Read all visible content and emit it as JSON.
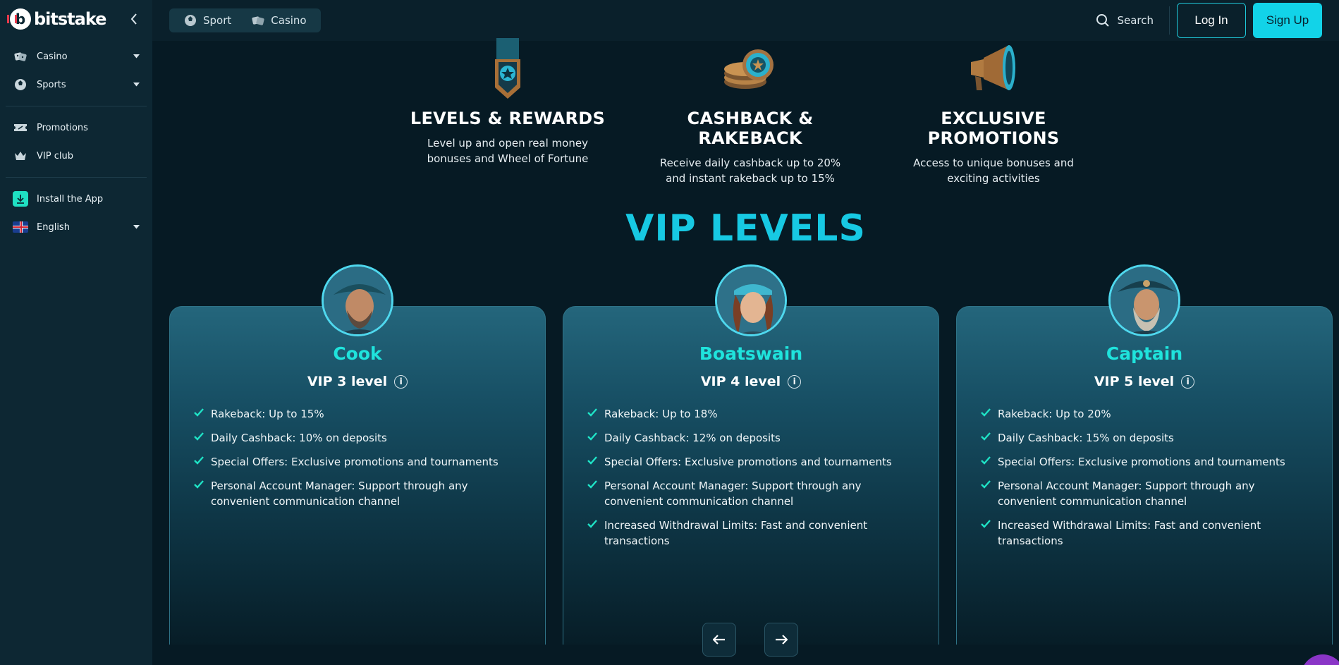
{
  "brand": {
    "name": "bitstake"
  },
  "sidebar": {
    "items": [
      {
        "label": "Casino",
        "icon": "dice-icon",
        "has_dropdown": true
      },
      {
        "label": "Sports",
        "icon": "ball-icon",
        "has_dropdown": true
      },
      {
        "label": "Promotions",
        "icon": "ticket-icon",
        "has_dropdown": false
      },
      {
        "label": "VIP club",
        "icon": "crown-icon",
        "has_dropdown": false
      },
      {
        "label": "Install the App",
        "icon": "download-icon",
        "has_dropdown": false
      },
      {
        "label": "English",
        "icon": "uk-flag-icon",
        "has_dropdown": true
      }
    ]
  },
  "topbar": {
    "tabs": [
      {
        "label": "Sport",
        "icon": "ball-icon"
      },
      {
        "label": "Casino",
        "icon": "dice-icon"
      }
    ],
    "search_label": "Search",
    "login_label": "Log In",
    "signup_label": "Sign Up"
  },
  "features": [
    {
      "title": "LEVELS & REWARDS",
      "text": "Level up and open real money\nbonuses and Wheel of Fortune",
      "icon": "medal-icon"
    },
    {
      "title": "CASHBACK & RAKEBACK",
      "text": "Receive daily cashback up to 20%\nand instant rakeback up to 15%",
      "icon": "coins-icon"
    },
    {
      "title": "EXCLUSIVE PROMOTIONS",
      "text": "Access to unique bonuses and\nexciting activities",
      "icon": "megaphone-icon"
    }
  ],
  "vip_title": "VIP LEVELS",
  "levels": [
    {
      "rank": "Cook",
      "level": "VIP 3 level",
      "perks": [
        "Rakeback: Up to 15%",
        "Daily Cashback: 10% on deposits",
        "Special Offers: Exclusive promotions and tournaments",
        "Personal Account Manager: Support through any convenient communication channel"
      ]
    },
    {
      "rank": "Boatswain",
      "level": "VIP 4 level",
      "perks": [
        "Rakeback: Up to 18%",
        "Daily Cashback: 12% on deposits",
        "Special Offers: Exclusive promotions and tournaments",
        "Personal Account Manager: Support through any convenient communication channel",
        "Increased Withdrawal Limits: Fast and convenient transactions"
      ]
    },
    {
      "rank": "Captain",
      "level": "VIP 5 level",
      "perks": [
        "Rakeback: Up to 20%",
        "Daily Cashback: 15% on deposits",
        "Special Offers: Exclusive promotions and tournaments",
        "Personal Account Manager: Support through any convenient communication channel",
        "Increased Withdrawal Limits: Fast and convenient transactions"
      ]
    }
  ],
  "colors": {
    "accent": "#12d3e8",
    "rank": "#1fe3dc",
    "bg": "#061a24",
    "sidebar": "#0d2733",
    "chat": "#8a35c7"
  }
}
